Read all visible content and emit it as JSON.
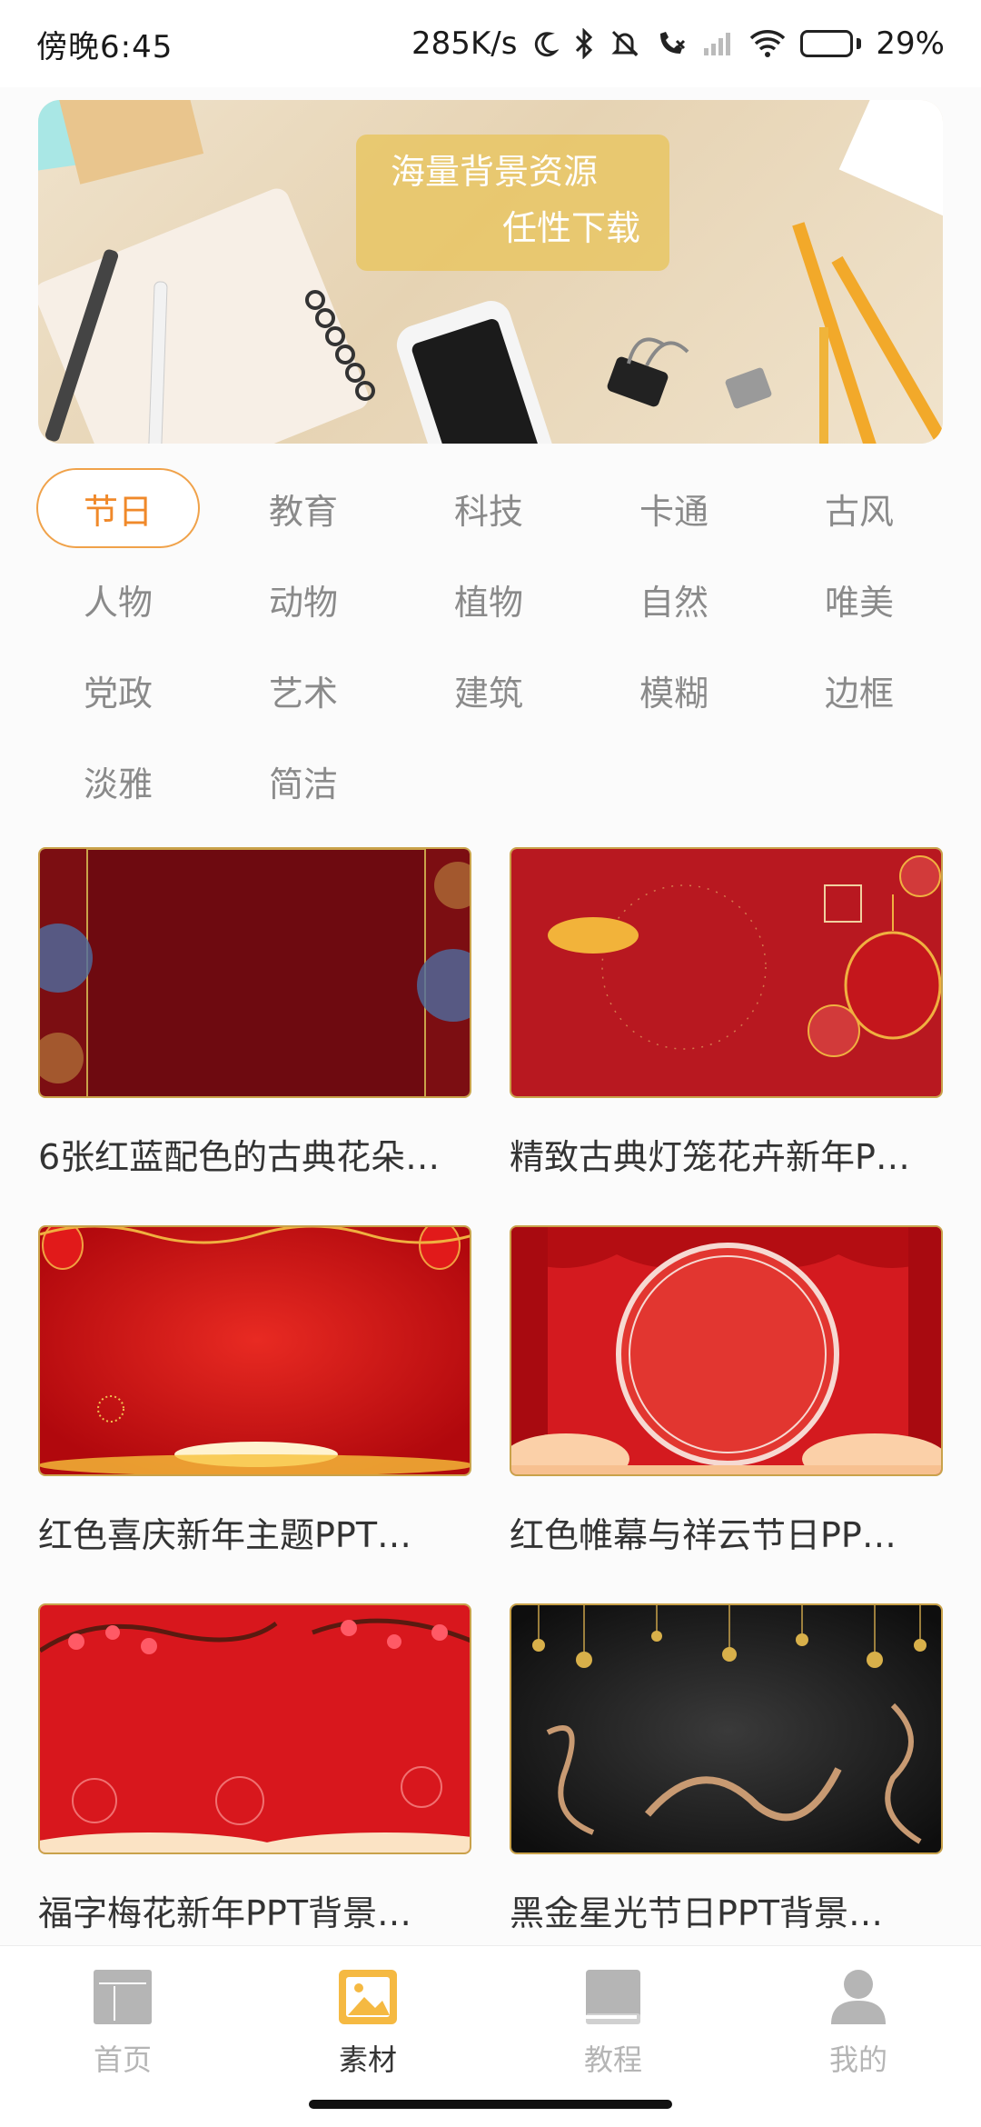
{
  "status": {
    "time": "傍晚6:45",
    "net_speed": "285K/s",
    "battery": "29%",
    "battery_level": 0.29
  },
  "banner": {
    "line1": "海量背景资源",
    "line2": "任性下载"
  },
  "categories": [
    {
      "label": "节日",
      "active": true
    },
    {
      "label": "教育"
    },
    {
      "label": "科技"
    },
    {
      "label": "卡通"
    },
    {
      "label": "古风"
    },
    {
      "label": "人物"
    },
    {
      "label": "动物"
    },
    {
      "label": "植物"
    },
    {
      "label": "自然"
    },
    {
      "label": "唯美"
    },
    {
      "label": "党政"
    },
    {
      "label": "艺术"
    },
    {
      "label": "建筑"
    },
    {
      "label": "模糊"
    },
    {
      "label": "边框"
    },
    {
      "label": "淡雅"
    },
    {
      "label": "简洁"
    }
  ],
  "cards": [
    {
      "title": "6张红蓝配色的古典花朵…"
    },
    {
      "title": "精致古典灯笼花卉新年P…"
    },
    {
      "title": "红色喜庆新年主题PPT…"
    },
    {
      "title": "红色帷幕与祥云节日PP…"
    },
    {
      "title": "福字梅花新年PPT背景…"
    },
    {
      "title": "黑金星光节日PPT背景…"
    }
  ],
  "nav": [
    {
      "label": "首页",
      "icon": "home-icon"
    },
    {
      "label": "素材",
      "icon": "image-icon",
      "active": true
    },
    {
      "label": "教程",
      "icon": "book-icon"
    },
    {
      "label": "我的",
      "icon": "user-icon"
    }
  ],
  "colors": {
    "accent": "#f0892a",
    "nav_active": "#f5b942",
    "nav_inactive": "#b5b5b5"
  }
}
